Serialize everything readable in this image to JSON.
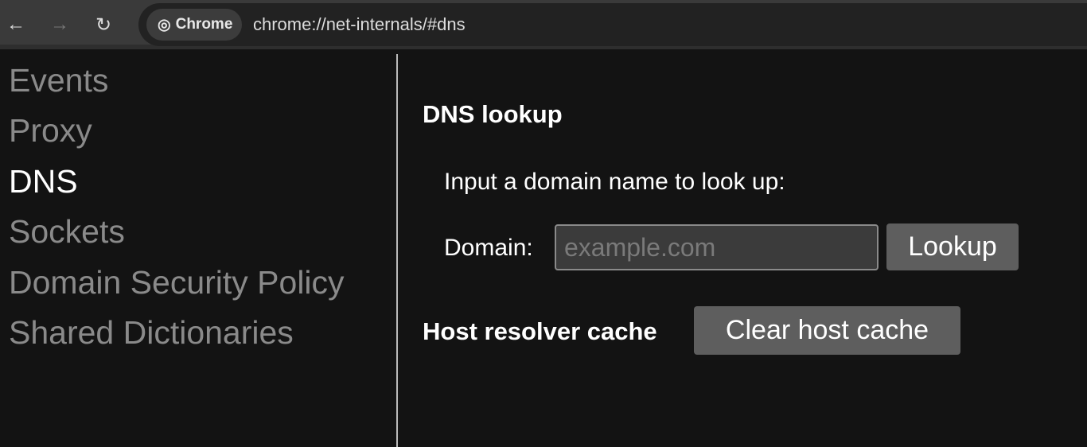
{
  "toolbar": {
    "chip_label": "Chrome",
    "url": "chrome://net-internals/#dns"
  },
  "sidebar": {
    "items": [
      {
        "label": "Events"
      },
      {
        "label": "Proxy"
      },
      {
        "label": "DNS"
      },
      {
        "label": "Sockets"
      },
      {
        "label": "Domain Security Policy"
      },
      {
        "label": "Shared Dictionaries"
      }
    ]
  },
  "main": {
    "title": "DNS lookup",
    "instruction": "Input a domain name to look up:",
    "domain_label": "Domain:",
    "domain_placeholder": "example.com",
    "lookup_label": "Lookup",
    "cache_label": "Host resolver cache",
    "clear_label": "Clear host cache"
  }
}
